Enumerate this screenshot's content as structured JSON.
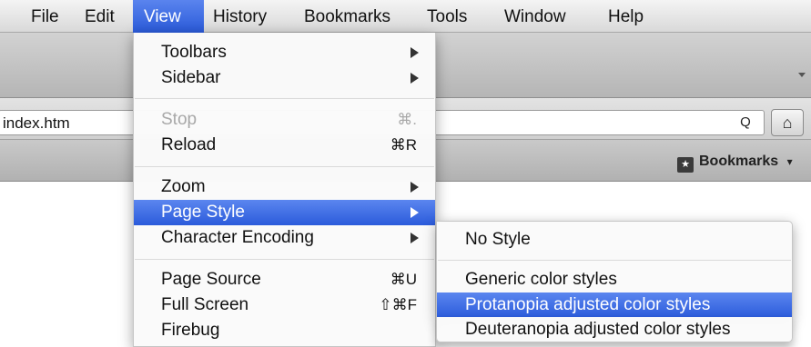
{
  "menubar": {
    "items": [
      "File",
      "Edit",
      "View",
      "History",
      "Bookmarks",
      "Tools",
      "Window",
      "Help"
    ],
    "active": "View"
  },
  "browser": {
    "url_text": "index.htm",
    "search_glyph": "Q",
    "home_glyph": "⌂",
    "bookmarks_label": "Bookmarks",
    "bookmarks_chevron": "▾"
  },
  "view_menu": {
    "items": [
      {
        "label": "Toolbars",
        "submenu": true
      },
      {
        "label": "Sidebar",
        "submenu": true
      },
      {
        "label": "Stop",
        "shortcut": "⌘.",
        "disabled": true
      },
      {
        "label": "Reload",
        "shortcut": "⌘R"
      },
      {
        "label": "Zoom",
        "submenu": true
      },
      {
        "label": "Page Style",
        "submenu": true,
        "highlighted": true
      },
      {
        "label": "Character Encoding",
        "submenu": true
      },
      {
        "label": "Page Source",
        "shortcut": "⌘U"
      },
      {
        "label": "Full Screen",
        "shortcut": "⇧⌘F"
      },
      {
        "label": "Firebug"
      }
    ]
  },
  "page_style_menu": {
    "items": [
      {
        "label": "No Style"
      },
      {
        "label": "Generic color styles"
      },
      {
        "label": "Protanopia adjusted color styles",
        "highlighted": true
      },
      {
        "label": "Deuteranopia adjusted color styles"
      }
    ]
  },
  "colors": {
    "highlight": "#2b5bdb",
    "menu_bg": "#fafafa",
    "disabled_text": "#a8a8a8"
  }
}
